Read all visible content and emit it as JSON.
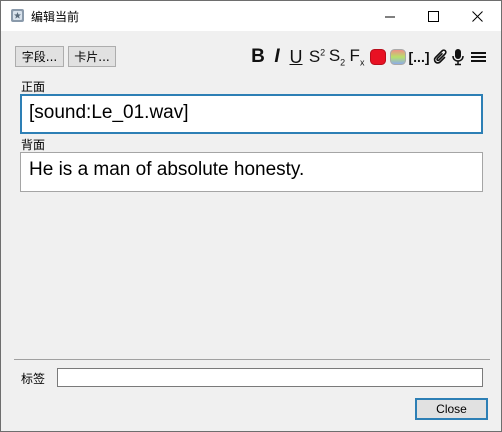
{
  "window": {
    "title": "编辑当前",
    "icon": "anki-app-icon"
  },
  "header": {
    "fields_button": "字段...",
    "cards_button": "卡片..."
  },
  "toolbar": {
    "bold": "B",
    "italic": "I",
    "underline": "U",
    "superscript_base": "S",
    "superscript_mark": "2",
    "subscript_base": "S",
    "subscript_mark": "2",
    "clear_base": "F",
    "clear_mark": "x",
    "cloze": "[...]",
    "text_color": "#e81123",
    "icons": [
      "bold-icon",
      "italic-icon",
      "underline-icon",
      "superscript-icon",
      "subscript-icon",
      "clear-format-icon",
      "text-color-icon",
      "highlight-color-icon",
      "cloze-icon",
      "attach-icon",
      "record-audio-icon",
      "more-menu-icon"
    ]
  },
  "fields": [
    {
      "label": "正面",
      "value": "[sound:Le_01.wav]"
    },
    {
      "label": "背面",
      "value": "He is a man of absolute honesty."
    }
  ],
  "tags": {
    "label": "标签",
    "value": ""
  },
  "footer": {
    "close_button": "Close"
  },
  "colors": {
    "focus_border": "#2d7fb5",
    "background": "#f0f0f0"
  }
}
